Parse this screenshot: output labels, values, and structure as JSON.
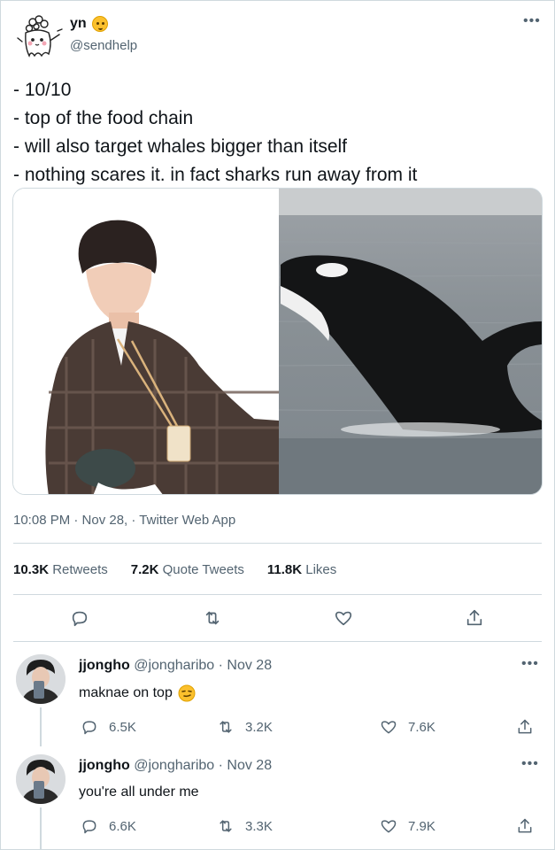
{
  "tweet": {
    "display_name": "yn",
    "handle": "@sendhelp",
    "lines": [
      "- 10/10",
      "- top of the food chain",
      "- will also target whales bigger than itself",
      "- nothing scares it. in fact sharks run away from it"
    ],
    "meta": "10:08 PM · Nov 28, · Twitter Web App",
    "stats": {
      "retweets_count": "10.3K",
      "retweets_label": "Retweets",
      "quotes_count": "7.2K",
      "quotes_label": "Quote Tweets",
      "likes_count": "11.8K",
      "likes_label": "Likes"
    }
  },
  "replies": [
    {
      "name": "jjongho",
      "handle_date": "@jongharibo · Nov 28",
      "text": "maknae on top",
      "has_emoji": true,
      "reply_count": "6.5K",
      "retweet_count": "3.2K",
      "like_count": "7.6K"
    },
    {
      "name": "jjongho",
      "handle_date": "@jongharibo · Nov 28",
      "text": "you're all under me",
      "has_emoji": false,
      "reply_count": "6.6K",
      "retweet_count": "3.3K",
      "like_count": "7.9K"
    }
  ],
  "icons": {
    "reply": "reply-icon",
    "retweet": "retweet-icon",
    "like": "heart-icon",
    "share": "share-icon",
    "more": "more-icon"
  },
  "colors": {
    "muted": "#536471",
    "border": "#cfd9de",
    "text": "#0f1419"
  }
}
